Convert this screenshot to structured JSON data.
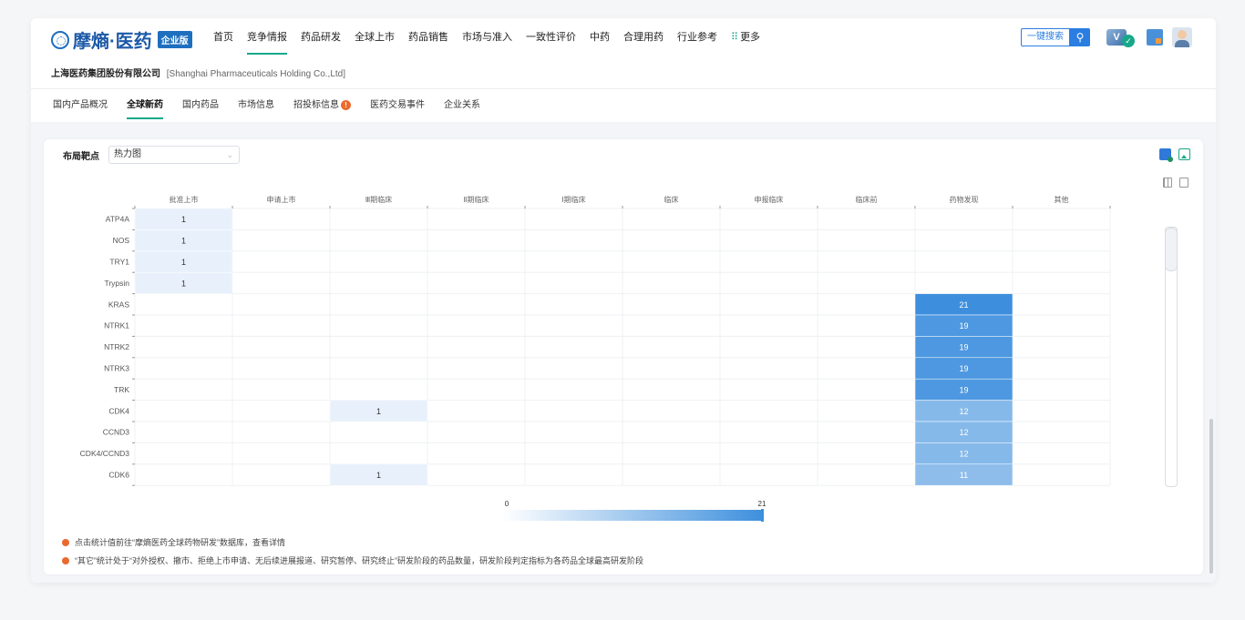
{
  "brand": {
    "logo_text": "摩熵·医药",
    "badge": "企业版",
    "accent": "#17a889",
    "blue": "#2a7de1"
  },
  "nav": {
    "items": [
      {
        "label": "首页",
        "active": false
      },
      {
        "label": "竞争情报",
        "active": true
      },
      {
        "label": "药品研发",
        "active": false
      },
      {
        "label": "全球上市",
        "active": false
      },
      {
        "label": "药品销售",
        "active": false
      },
      {
        "label": "市场与准入",
        "active": false
      },
      {
        "label": "一致性评价",
        "active": false
      },
      {
        "label": "中药",
        "active": false
      },
      {
        "label": "合理用药",
        "active": false
      },
      {
        "label": "行业参考",
        "active": false
      }
    ],
    "more_label": "更多",
    "search_label": "一键搜索",
    "search_icon": "search-icon",
    "vip_letter": "V"
  },
  "company": {
    "name_cn": "上海医药集团股份有限公司",
    "name_en": "[Shanghai Pharmaceuticals Holding Co.,Ltd]"
  },
  "subtabs": [
    {
      "label": "国内产品概况",
      "active": false
    },
    {
      "label": "全球新药",
      "active": true
    },
    {
      "label": "国内药品",
      "active": false
    },
    {
      "label": "市场信息",
      "active": false
    },
    {
      "label": "招投标信息",
      "active": false,
      "warn": "!"
    },
    {
      "label": "医药交易事件",
      "active": false
    },
    {
      "label": "企业关系",
      "active": false
    }
  ],
  "card": {
    "label": "布局靶点",
    "select_value": "热力图"
  },
  "chart_data": {
    "type": "heatmap",
    "x_categories": [
      "批准上市",
      "申请上市",
      "Ⅲ期临床",
      "Ⅱ期临床",
      "Ⅰ期临床",
      "临床",
      "申报临床",
      "临床前",
      "药物发现",
      "其他"
    ],
    "y_categories": [
      "ATP4A",
      "NOS",
      "TRY1",
      "Trypsin",
      "KRAS",
      "NTRK1",
      "NTRK2",
      "NTRK3",
      "TRK",
      "CDK4",
      "CCND3",
      "CDK4/CCND3",
      "CDK6"
    ],
    "values": [
      [
        1,
        null,
        null,
        null,
        null,
        null,
        null,
        null,
        null,
        null
      ],
      [
        1,
        null,
        null,
        null,
        null,
        null,
        null,
        null,
        null,
        null
      ],
      [
        1,
        null,
        null,
        null,
        null,
        null,
        null,
        null,
        null,
        null
      ],
      [
        1,
        null,
        null,
        null,
        null,
        null,
        null,
        null,
        null,
        null
      ],
      [
        null,
        null,
        null,
        null,
        null,
        null,
        null,
        null,
        21,
        null
      ],
      [
        null,
        null,
        null,
        null,
        null,
        null,
        null,
        null,
        19,
        null
      ],
      [
        null,
        null,
        null,
        null,
        null,
        null,
        null,
        null,
        19,
        null
      ],
      [
        null,
        null,
        null,
        null,
        null,
        null,
        null,
        null,
        19,
        null
      ],
      [
        null,
        null,
        null,
        null,
        null,
        null,
        null,
        null,
        19,
        null
      ],
      [
        null,
        null,
        1,
        null,
        null,
        null,
        null,
        null,
        12,
        null
      ],
      [
        null,
        null,
        null,
        null,
        null,
        null,
        null,
        null,
        12,
        null
      ],
      [
        null,
        null,
        null,
        null,
        null,
        null,
        null,
        null,
        12,
        null
      ],
      [
        null,
        null,
        1,
        null,
        null,
        null,
        null,
        null,
        11,
        null
      ]
    ],
    "visual_map": {
      "min": "0",
      "max": "21",
      "min_value": 0,
      "max_value": 21
    },
    "color_low": "#f4f8fd",
    "color_high": "#3d8fdd"
  },
  "notes": [
    "点击统计值前往“摩熵医药全球药物研发”数据库，查看详情",
    "“其它”统计处于“对外授权、撤市、拒绝上市申请、无后续进展报道、研究暂停、研究终止”研发阶段的药品数量，研发阶段判定指标为各药品全球最高研发阶段"
  ]
}
